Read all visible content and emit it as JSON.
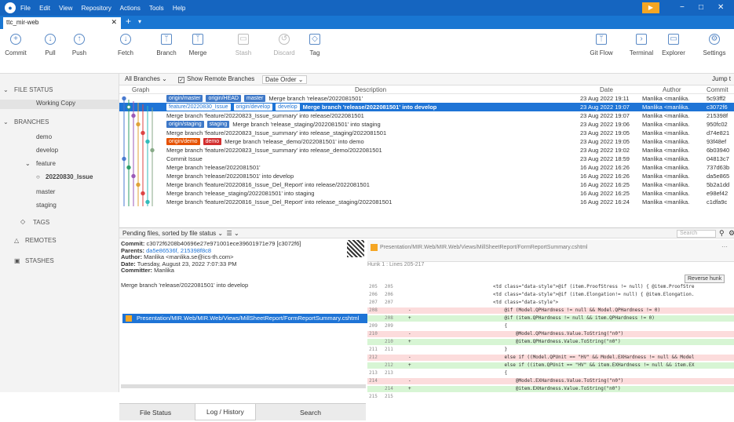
{
  "titlebar": {
    "menu": [
      "File",
      "Edit",
      "View",
      "Repository",
      "Actions",
      "Tools",
      "Help"
    ],
    "min": "−",
    "max": "□",
    "close": "✕"
  },
  "tab": {
    "name": "ttc_mir-web",
    "close": "✕",
    "plus": "+"
  },
  "toolbar": {
    "commit": "Commit",
    "pull": "Pull",
    "push": "Push",
    "fetch": "Fetch",
    "branch": "Branch",
    "merge": "Merge",
    "stash": "Stash",
    "discard": "Discard",
    "tag": "Tag",
    "gitflow": "Git Flow",
    "terminal": "Terminal",
    "explorer": "Explorer",
    "settings": "Settings"
  },
  "sidebar": {
    "file_status": "FILE STATUS",
    "working_copy": "Working Copy",
    "branches": "BRANCHES",
    "demo": "demo",
    "develop": "develop",
    "feature": "feature",
    "current": "20220830_Issue",
    "master": "master",
    "staging": "staging",
    "tags": "TAGS",
    "remotes": "REMOTES",
    "stashes": "STASHES"
  },
  "filterbar": {
    "all_branches": "All Branches",
    "show_remote": "Show Remote Branches",
    "date_order": "Date Order",
    "jump": "Jump t"
  },
  "columns": {
    "graph": "Graph",
    "description": "Description",
    "date": "Date",
    "author": "Author",
    "commit": "Commit"
  },
  "commits": [
    {
      "labels": [
        [
          "b",
          "origin/master"
        ],
        [
          "b",
          "origin/HEAD"
        ],
        [
          "b",
          "master"
        ]
      ],
      "desc": "Merge branch 'release/2022081501'",
      "date": "23 Aug 2022 19:11",
      "author": "Manlika <manlika.",
      "hash": "5c93ff2"
    },
    {
      "labels": [
        [
          "w",
          "feature/20220830_Issue"
        ],
        [
          "w",
          "origin/develop"
        ],
        [
          "w",
          "develop"
        ]
      ],
      "desc": "Merge branch 'release/2022081501' into develop",
      "date": "23 Aug 2022 19:07",
      "author": "Manlika <manlika.",
      "hash": "c3072f6",
      "selected": true
    },
    {
      "labels": [],
      "desc": "Merge branch 'feature/20220823_Issue_summary' into release/2022081501",
      "date": "23 Aug 2022 19:07",
      "author": "Manlika <manlika.",
      "hash": "215398f"
    },
    {
      "labels": [
        [
          "b",
          "origin/staging"
        ],
        [
          "b",
          "staging"
        ]
      ],
      "desc": "Merge branch 'release_staging/2022081501' into staging",
      "date": "23 Aug 2022 19:06",
      "author": "Manlika <manlika.",
      "hash": "950fc02"
    },
    {
      "labels": [],
      "desc": "Merge branch 'feature/20220823_Issue_summary' into release_staging/2022081501",
      "date": "23 Aug 2022 19:05",
      "author": "Manlika <manlika.",
      "hash": "d74e821"
    },
    {
      "labels": [
        [
          "o",
          "origin/demo"
        ],
        [
          "r",
          "demo"
        ]
      ],
      "desc": "Merge branch 'release_demo/2022081501' into demo",
      "date": "23 Aug 2022 19:05",
      "author": "Manlika <manlika.",
      "hash": "93f48ef"
    },
    {
      "labels": [],
      "desc": "Merge branch 'feature/20220823_Issue_summary' into release_demo/2022081501",
      "date": "23 Aug 2022 19:02",
      "author": "Manlika <manlika.",
      "hash": "6b03940"
    },
    {
      "labels": [],
      "desc": "Commit Issue",
      "date": "23 Aug 2022 18:59",
      "author": "Manlika <manlika.",
      "hash": "04813c7"
    },
    {
      "labels": [],
      "desc": "Merge branch 'release/2022081501'",
      "date": "16 Aug 2022 16:26",
      "author": "Manlika <manlika.",
      "hash": "737d63b"
    },
    {
      "labels": [],
      "desc": "Merge branch 'release/2022081501' into develop",
      "date": "16 Aug 2022 16:26",
      "author": "Manlika <manlika.",
      "hash": "da5e865"
    },
    {
      "labels": [],
      "desc": "Merge branch 'feature/20220816_Issue_Del_Report' into release/2022081501",
      "date": "16 Aug 2022 16:25",
      "author": "Manlika <manlika.",
      "hash": "5b2a1dd"
    },
    {
      "labels": [],
      "desc": "Merge branch 'release_staging/2022081501' into staging",
      "date": "16 Aug 2022 16:25",
      "author": "Manlika <manlika.",
      "hash": "e98ef42"
    },
    {
      "labels": [],
      "desc": "Merge branch 'feature/20220816_Issue_Del_Report' into release_staging/2022081501",
      "date": "16 Aug 2022 16:24",
      "author": "Manlika <manlika.",
      "hash": "c1dfa9c"
    }
  ],
  "pending": {
    "text": "Pending files, sorted by file status",
    "search": "Search"
  },
  "details": {
    "commit_label": "Commit:",
    "commit_val": "c3072f6208b40696e27e971001ece39601971e79 [c3072f6]",
    "parents_label": "Parents:",
    "parents_val": "da5e86536f, 215398f8c8",
    "author_label": "Author:",
    "author_val": "Manlika <manlika.se@ics-th.com>",
    "date_label": "Date:",
    "date_val": "Tuesday, August 23, 2022 7:07:33 PM",
    "committer_label": "Committer:",
    "committer_val": "Manlika",
    "message": "Merge branch 'release/2022081501' into develop"
  },
  "file": "Presentation/MIR.Web/MIR.Web/Views/MillSheetReport/FormReportSummary.cshtml",
  "diff": {
    "hunk": "Hunk 1 : Lines 205-217",
    "reverse": "Reverse hunk",
    "lines": [
      {
        "t": "ctx",
        "a": "205",
        "b": "205",
        "m": "",
        "c": "<td class=\"data-style\">@if (item.ProofStress != null) { @item.ProofStre"
      },
      {
        "t": "ctx",
        "a": "206",
        "b": "206",
        "m": "",
        "c": "<td class=\"data-style\">@if (item.Elongation!= null) { @item.Elongation."
      },
      {
        "t": "ctx",
        "a": "207",
        "b": "207",
        "m": "",
        "c": "<td class=\"data-style\">"
      },
      {
        "t": "del",
        "a": "208",
        "b": "",
        "m": "-",
        "c": "    @if (Model.QPHardness != null && Model.QPHardness != 0)"
      },
      {
        "t": "add",
        "a": "",
        "b": "208",
        "m": "+",
        "c": "    @if (item.QPHardness != null && item.QPHardness != 0)"
      },
      {
        "t": "ctx",
        "a": "209",
        "b": "209",
        "m": "",
        "c": "    {"
      },
      {
        "t": "del",
        "a": "210",
        "b": "",
        "m": "-",
        "c": "        @Model.QPHardness.Value.ToString(\"n0\")"
      },
      {
        "t": "add",
        "a": "",
        "b": "210",
        "m": "+",
        "c": "        @item.QPHardness.Value.ToString(\"n0\")"
      },
      {
        "t": "ctx",
        "a": "211",
        "b": "211",
        "m": "",
        "c": "    }"
      },
      {
        "t": "del",
        "a": "212",
        "b": "",
        "m": "-",
        "c": "    else if ((Model.QPUnit == \"HV\" && Model.EXHardness != null && Model"
      },
      {
        "t": "add",
        "a": "",
        "b": "212",
        "m": "+",
        "c": "    else if ((item.QPUnit == \"HV\" && item.EXHardness != null && item.EX"
      },
      {
        "t": "ctx",
        "a": "213",
        "b": "213",
        "m": "",
        "c": "    {"
      },
      {
        "t": "del",
        "a": "214",
        "b": "",
        "m": "-",
        "c": "        @Model.EXHardness.Value.ToString(\"n0\")"
      },
      {
        "t": "add",
        "a": "",
        "b": "214",
        "m": "+",
        "c": "        @item.EXHardness.Value.ToString(\"n0\")"
      },
      {
        "t": "ctx",
        "a": "215",
        "b": "215",
        "m": "",
        "c": ""
      }
    ]
  },
  "bottom_tabs": [
    "File Status",
    "Log / History",
    "Search"
  ]
}
